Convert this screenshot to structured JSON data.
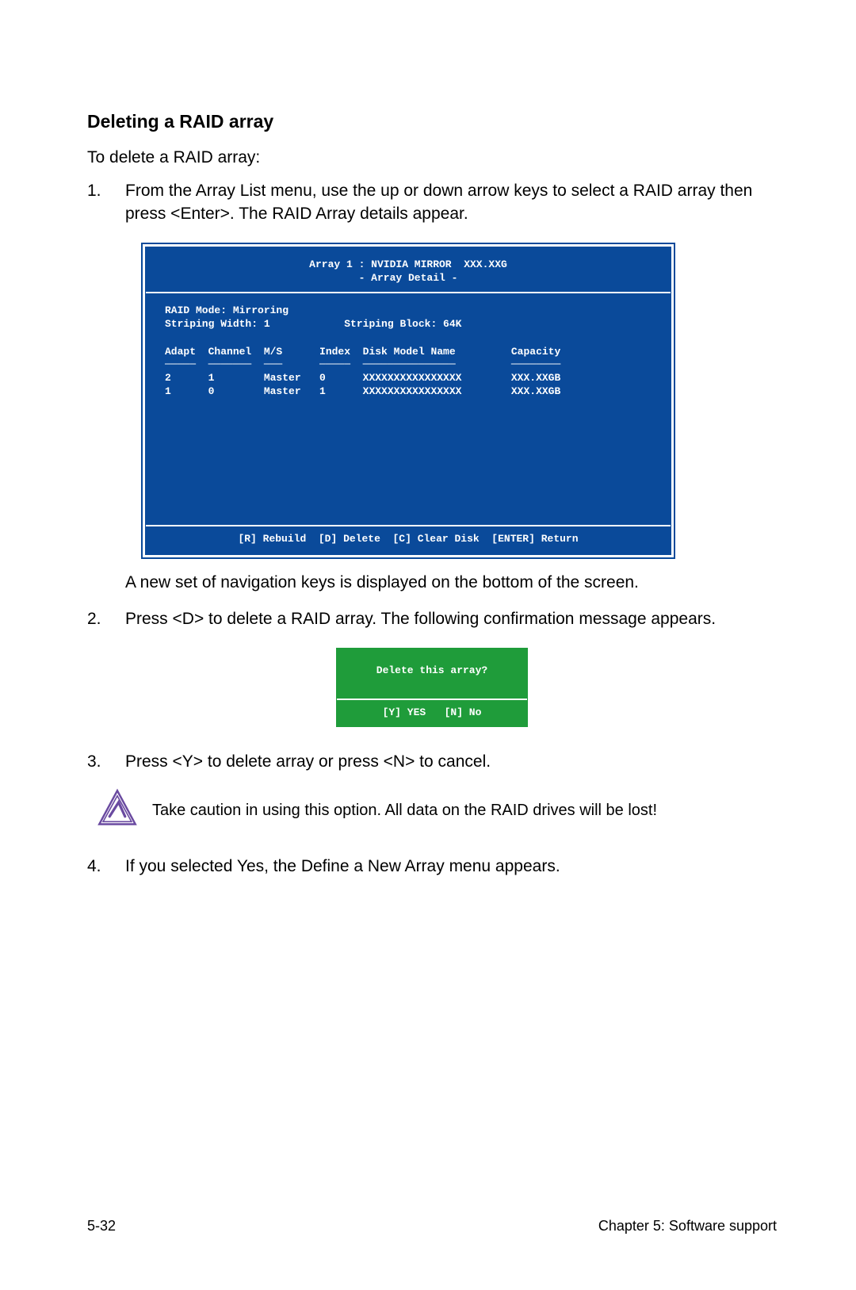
{
  "heading": "Deleting a RAID array",
  "intro": "To delete a RAID array:",
  "steps": {
    "s1": "From the Array List menu, use the up or down arrow keys to select a RAID array then press <Enter>. The RAID Array details appear.",
    "s1_after": "A new set of  navigation keys is displayed on the bottom of the screen.",
    "s2": "Press <D> to delete a RAID array. The following confirmation message appears.",
    "s3": "Press <Y> to delete array or press <N> to cancel.",
    "s4": "If you selected Yes, the Define a New Array menu appears."
  },
  "bios": {
    "title_line": "Array 1 : NVIDIA MIRROR  XXX.XXG",
    "subtitle_line": "- Array Detail -",
    "mode_line": "RAID Mode: Mirroring",
    "width_block_line": "Striping Width: 1            Striping Block: 64K",
    "header_row": "Adapt  Channel  M/S      Index  Disk Model Name         Capacity",
    "hr_row": "─────  ───────  ───      ─────  ───────────────         ────────",
    "row1": "2      1        Master   0      XXXXXXXXXXXXXXXX        XXX.XXGB",
    "row2": "1      0        Master   1      XXXXXXXXXXXXXXXX        XXX.XXGB",
    "footer": "[R] Rebuild  [D] Delete  [C] Clear Disk  [ENTER] Return"
  },
  "confirm": {
    "question": "Delete this array?",
    "options": "[Y] YES   [N] No"
  },
  "caution": "Take caution in using this option. All data on the RAID drives will be lost!",
  "footer": {
    "left": "5-32",
    "right": "Chapter 5: Software support"
  }
}
